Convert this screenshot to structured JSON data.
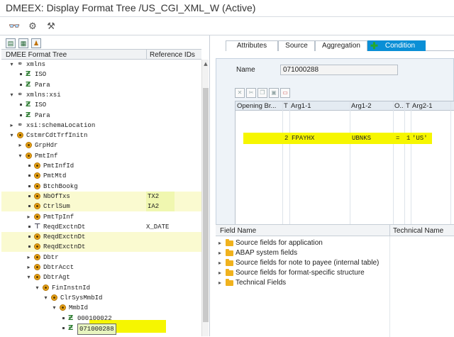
{
  "window": {
    "title": "DMEEX: Display Format Tree /US_CGI_XML_W (Active)"
  },
  "toolbar": {
    "icons": [
      "glasses-icon",
      "display-change-icon",
      "hammer-icon"
    ]
  },
  "tree": {
    "header": {
      "col1": "DMEE Format Tree",
      "col2": "Reference IDs"
    },
    "rows": [
      {
        "label": "xmlns",
        "ref": "",
        "icon": "link-icon",
        "level": 2,
        "tw": "▾",
        "hl": false
      },
      {
        "label": "ISO",
        "ref": "",
        "icon": "element-icon",
        "level": 3,
        "tw": "•",
        "hl": false
      },
      {
        "label": "Para",
        "ref": "",
        "icon": "element-icon",
        "level": 3,
        "tw": "•",
        "hl": false
      },
      {
        "label": "xmlns:xsi",
        "ref": "",
        "icon": "link-icon",
        "level": 2,
        "tw": "▾",
        "hl": false
      },
      {
        "label": "ISO",
        "ref": "",
        "icon": "element-icon",
        "level": 3,
        "tw": "•",
        "hl": false
      },
      {
        "label": "Para",
        "ref": "",
        "icon": "element-icon",
        "level": 3,
        "tw": "•",
        "hl": false
      },
      {
        "label": "xsi:schemaLocation",
        "ref": "",
        "icon": "link-icon",
        "level": 2,
        "tw": "▸",
        "hl": false
      },
      {
        "label": "CstmrCdtTrfInitn",
        "ref": "",
        "icon": "atom-icon",
        "level": 2,
        "tw": "▾",
        "hl": false
      },
      {
        "label": "GrpHdr",
        "ref": "",
        "icon": "atom-icon",
        "level": 3,
        "tw": "▸",
        "hl": false
      },
      {
        "label": "PmtInf",
        "ref": "",
        "icon": "atom-icon",
        "level": 3,
        "tw": "▾",
        "hl": false
      },
      {
        "label": "PmtInfId",
        "ref": "",
        "icon": "atom-icon",
        "level": 4,
        "tw": "•",
        "hl": false
      },
      {
        "label": "PmtMtd",
        "ref": "",
        "icon": "atom-icon",
        "level": 4,
        "tw": "•",
        "hl": false
      },
      {
        "label": "BtchBookg",
        "ref": "",
        "icon": "atom-icon",
        "level": 4,
        "tw": "•",
        "hl": false
      },
      {
        "label": "NbOfTxs",
        "ref": "TX2",
        "icon": "atom-icon",
        "level": 4,
        "tw": "•",
        "hl": true
      },
      {
        "label": "CtrlSum",
        "ref": "IA2",
        "icon": "atom-icon",
        "level": 4,
        "tw": "•",
        "hl": true
      },
      {
        "label": "PmtTpInf",
        "ref": "",
        "icon": "atom-icon",
        "level": 4,
        "tw": "▸",
        "hl": false
      },
      {
        "label": "ReqdExctnDt",
        "ref": "X_DATE",
        "icon": "technical-node-icon",
        "level": 4,
        "tw": "•",
        "hl": false
      },
      {
        "label": "ReqdExctnDt",
        "ref": "",
        "icon": "atom-icon",
        "level": 4,
        "tw": "•",
        "hl": true
      },
      {
        "label": "ReqdExctnDt",
        "ref": "",
        "icon": "atom-icon",
        "level": 4,
        "tw": "•",
        "hl": true
      },
      {
        "label": "Dbtr",
        "ref": "",
        "icon": "atom-icon",
        "level": 4,
        "tw": "▸",
        "hl": false
      },
      {
        "label": "DbtrAcct",
        "ref": "",
        "icon": "atom-icon",
        "level": 4,
        "tw": "▸",
        "hl": false
      },
      {
        "label": "DbtrAgt",
        "ref": "",
        "icon": "atom-icon",
        "level": 4,
        "tw": "▾",
        "hl": false
      },
      {
        "label": "FinInstnId",
        "ref": "",
        "icon": "atom-icon",
        "level": 5,
        "tw": "▾",
        "hl": false
      },
      {
        "label": "ClrSysMmbId",
        "ref": "",
        "icon": "atom-icon",
        "level": 6,
        "tw": "▾",
        "hl": false
      },
      {
        "label": "MmbId",
        "ref": "",
        "icon": "atom-icon",
        "level": 7,
        "tw": "▾",
        "hl": false
      },
      {
        "label": "000100022",
        "ref": "",
        "icon": "element-icon",
        "level": 8,
        "tw": "•",
        "hl": false
      },
      {
        "label": "071000288",
        "ref": "",
        "icon": "element-icon",
        "level": 8,
        "tw": "•",
        "hl": false,
        "selected": true
      }
    ]
  },
  "tabs": [
    {
      "label": "Attributes",
      "active": false
    },
    {
      "label": "Source",
      "active": false
    },
    {
      "label": "Aggregation",
      "active": false
    },
    {
      "label": "Condition",
      "active": true
    }
  ],
  "condition": {
    "name_label": "Name",
    "name_value": "071000288",
    "columns": [
      "Opening Br...",
      "T",
      "Arg1-1",
      "Arg1-2",
      "O..",
      "T",
      "Arg2-1"
    ],
    "row": {
      "t1": "2",
      "arg11": "FPAYHX",
      "arg12": "UBNKS",
      "op": "=",
      "t2": "1",
      "arg21": "'US'"
    }
  },
  "fields": {
    "header": {
      "name": "Field Name",
      "tech": "Technical Name"
    },
    "items": [
      "Source fields for application",
      "ABAP system fields",
      "Source fields for note to payee (internal table)",
      "Source fields for format-specific structure",
      "Technical Fields"
    ]
  },
  "colors": {
    "accent": "#0a8fd6",
    "highlight": "#f6f600",
    "folder": "#f0b21e",
    "atom": "#e7a317"
  }
}
